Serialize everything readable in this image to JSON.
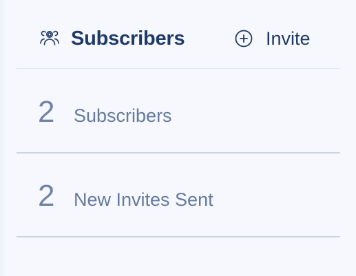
{
  "header": {
    "title": "Subscribers",
    "title_icon": "users-icon",
    "invite_label": "Invite",
    "invite_icon": "plus-circle-icon"
  },
  "stats": [
    {
      "value": "2",
      "label": "Subscribers"
    },
    {
      "value": "2",
      "label": "New Invites Sent"
    }
  ],
  "colors": {
    "background": "#f6f8fd",
    "title": "#1f3a68",
    "stat_text": "#6f84a8",
    "divider": "#c9d5e6"
  }
}
